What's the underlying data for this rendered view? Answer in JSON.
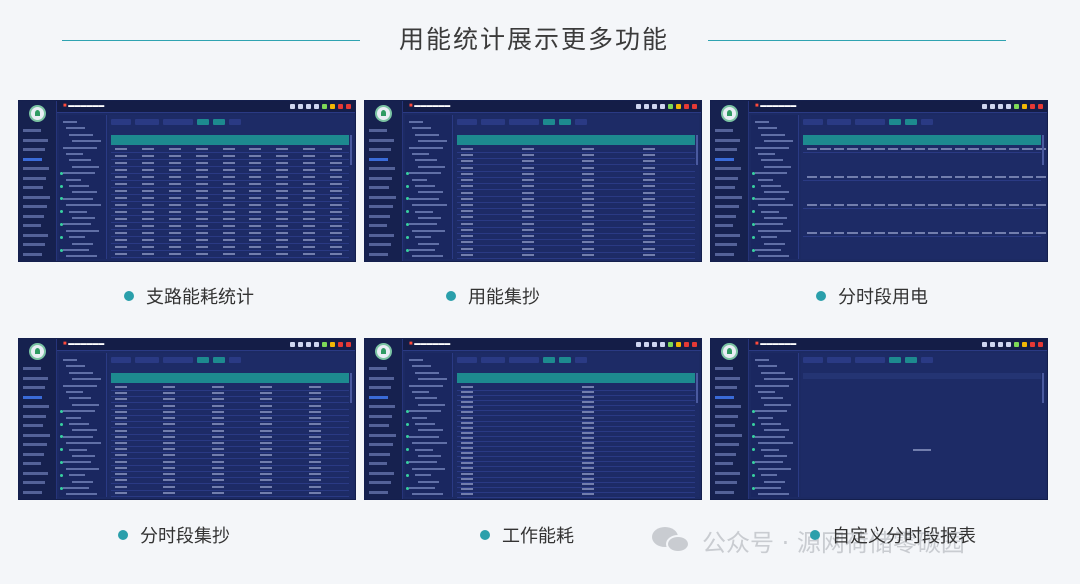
{
  "page": {
    "title": "用能统计展示更多功能"
  },
  "brand_color": "#1d8a8f",
  "accent": "#2a9fab",
  "cards": [
    {
      "caption": "支路能耗统计"
    },
    {
      "caption": "用能集抄"
    },
    {
      "caption": "分时段用电"
    },
    {
      "caption": "分时段集抄"
    },
    {
      "caption": "工作能耗"
    },
    {
      "caption": "自定义分时段报表"
    }
  ],
  "watermark": {
    "icon": "wechat-icon",
    "text": "公众号 · 源网荷储零碳园"
  }
}
